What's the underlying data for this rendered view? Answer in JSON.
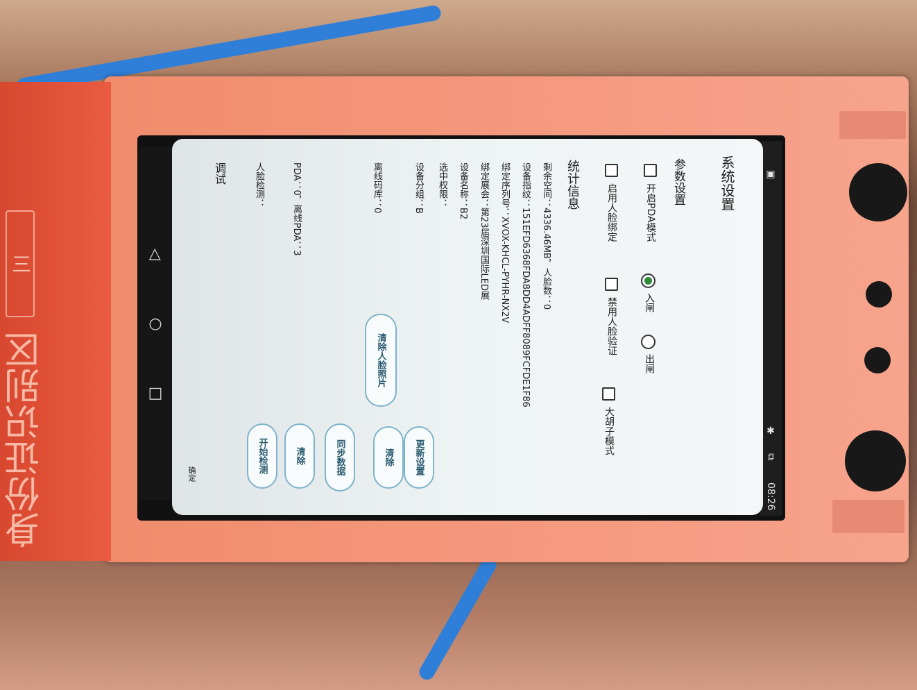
{
  "status_bar": {
    "time": "08:26"
  },
  "dialog": {
    "title": "系统设置",
    "params_header": "参数设置",
    "pda_mode": "开启PDA模式",
    "enable_face_bind": "启用人脸绑定",
    "radio_in": "入闸",
    "radio_out": "出闸",
    "disable_face_verify": "禁用人脸验证",
    "beard_mode": "大胡子模式",
    "stats_header": "统计信息",
    "free_space": "剩余空间：4336.46MB，人脸数：0",
    "device_fingerprint": "设备指纹：151EFD6368FDA8DD4ADFF8089FCFDE1F86",
    "bind_serial": "绑定序列号：XVOX-KHCL-PYHR-NX2V",
    "bind_exhibition": "绑定展会：第23届深圳国际LED展",
    "device_name": "设备名称：B2",
    "selected_permission": "选中权限：",
    "device_group": "设备分组：B",
    "offline_codebase": "离线码库：0",
    "pda_stats": "PDA：0，离线PDA：3",
    "face_detect": "人脸检测：",
    "debug": "调试",
    "confirm": "确定",
    "btn_update_settings": "更新设置",
    "btn_clear_1": "清除",
    "btn_clear_face_photos": "清除人脸照片",
    "btn_sync_data": "同步数据",
    "btn_clear_2": "清除",
    "btn_start_detect": "开始检测"
  },
  "kiosk": {
    "panel_text": "身份证识别区",
    "panel_logo": "三"
  },
  "colors": {
    "device_orange": "#f4957a",
    "red_panel": "#e0503a",
    "button_border": "#7fb3c9",
    "radio_selected": "#2f8a3a"
  },
  "icons": [
    "back-icon",
    "home-icon",
    "recents-icon",
    "bluetooth-icon",
    "cast-icon"
  ]
}
